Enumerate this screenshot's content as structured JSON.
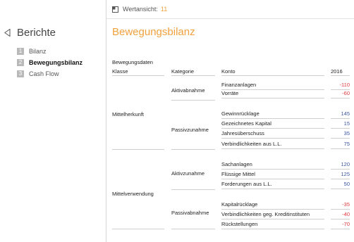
{
  "nav": {
    "title": "Berichte",
    "items": [
      {
        "num": "1",
        "label": "Bilanz"
      },
      {
        "num": "2",
        "label": "Bewegungsbilanz"
      },
      {
        "num": "3",
        "label": "Cash Flow"
      }
    ]
  },
  "toolbar": {
    "label": "Wertansicht:",
    "value": "11"
  },
  "page": {
    "title": "Bewegungsbilanz"
  },
  "table": {
    "caption": "Bewegungsdaten",
    "headers": {
      "klasse": "Klasse",
      "kategorie": "Kategorie",
      "konto": "Konto",
      "year": "2016"
    },
    "klassen": [
      "Mittelherkunft",
      "Mittelverwendung"
    ],
    "kategorien": [
      "Aktivabnahme",
      "Passivzunahme",
      "Aktivzunahme",
      "Passivabnahme"
    ],
    "rows": [
      {
        "konto": "Finanzanlagen",
        "value": "-110"
      },
      {
        "konto": "Vorräte",
        "value": "-60"
      },
      {
        "konto": "Gewinnrücklage",
        "value": "145"
      },
      {
        "konto": "Gezeichnetes Kapital",
        "value": "15"
      },
      {
        "konto": "Jahresüberschuss",
        "value": "35"
      },
      {
        "konto": "Verbindlichkeiten aus L.L.",
        "value": "75"
      },
      {
        "konto": "Sachanlagen",
        "value": "120"
      },
      {
        "konto": "Flüssige Mittel",
        "value": "125"
      },
      {
        "konto": "Forderungen aus L.L.",
        "value": "50"
      },
      {
        "konto": "Kapitalrücklage",
        "value": "-35"
      },
      {
        "konto": "Verbindlichkeiten geg. Kreditinstituten",
        "value": "-40"
      },
      {
        "konto": "Rückstellungen",
        "value": "-70"
      }
    ]
  },
  "colors": {
    "accent": "#f0a13c",
    "negative": "#e0383e",
    "positive": "#3a55a0"
  }
}
